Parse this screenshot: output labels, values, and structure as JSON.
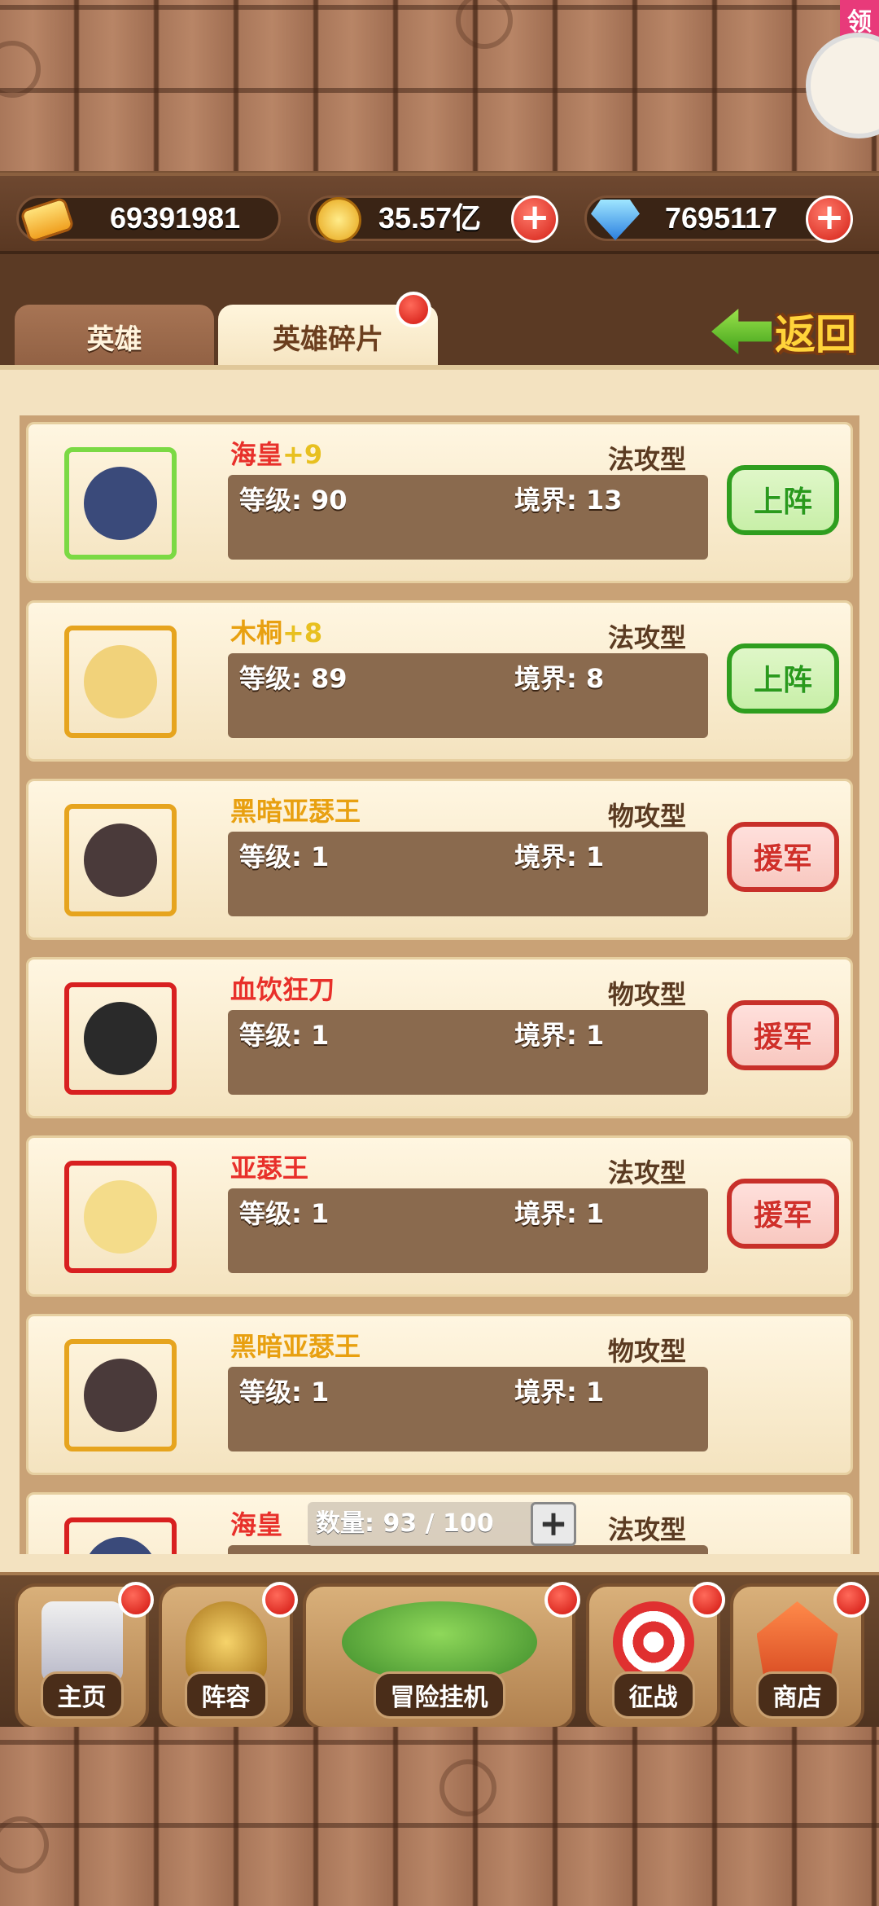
{
  "currency": {
    "tickets": "69391981",
    "gold": "35.57亿",
    "gems": "7695117"
  },
  "side_badge": "领",
  "tabs": [
    {
      "label": "英雄"
    },
    {
      "label": "英雄碎片"
    }
  ],
  "back_label": "返回",
  "heroes": [
    {
      "name": "海皇",
      "plus": "+9",
      "type": "法攻型",
      "level_label": "等级: 90",
      "realm_label": "境界: 13",
      "action": "上阵",
      "action_style": "green",
      "name_color": "#e8302a",
      "frame_color": "#7bd944",
      "face": "#3a4a7a"
    },
    {
      "name": "木桐",
      "plus": "+8",
      "type": "法攻型",
      "level_label": "等级: 89",
      "realm_label": "境界: 8",
      "action": "上阵",
      "action_style": "green",
      "name_color": "#e8a010",
      "frame_color": "#e6a41e",
      "face": "#f1d27a"
    },
    {
      "name": "黑暗亚瑟王",
      "plus": "",
      "type": "物攻型",
      "level_label": "等级: 1",
      "realm_label": "境界: 1",
      "action": "援军",
      "action_style": "red",
      "name_color": "#e8a010",
      "frame_color": "#e6a41e",
      "face": "#4a3a3a"
    },
    {
      "name": "血饮狂刀",
      "plus": "",
      "type": "物攻型",
      "level_label": "等级: 1",
      "realm_label": "境界: 1",
      "action": "援军",
      "action_style": "red",
      "name_color": "#e8302a",
      "frame_color": "#d82020",
      "face": "#2a2a2a"
    },
    {
      "name": "亚瑟王",
      "plus": "",
      "type": "法攻型",
      "level_label": "等级: 1",
      "realm_label": "境界: 1",
      "action": "援军",
      "action_style": "red",
      "name_color": "#e8302a",
      "frame_color": "#d82020",
      "face": "#f4dc8a"
    },
    {
      "name": "黑暗亚瑟王",
      "plus": "",
      "type": "物攻型",
      "level_label": "等级: 1",
      "realm_label": "境界: 1",
      "action": "",
      "action_style": "none",
      "name_color": "#e8a010",
      "frame_color": "#e6a41e",
      "face": "#4a3a3a"
    },
    {
      "name": "海皇",
      "plus": "",
      "type": "法攻型",
      "level_label": "",
      "realm_label": "",
      "action": "",
      "action_style": "none",
      "name_color": "#e8302a",
      "frame_color": "#d82020",
      "face": "#3a4a7a"
    }
  ],
  "count_label": "数量: 93 / 100",
  "nav": [
    {
      "label": "主页",
      "icon": "castle-icon"
    },
    {
      "label": "阵容",
      "icon": "knight-helmet-icon"
    },
    {
      "label": "冒险挂机",
      "icon": "floating-island-icon"
    },
    {
      "label": "征战",
      "icon": "target-icon"
    },
    {
      "label": "商店",
      "icon": "shop-icon"
    }
  ]
}
